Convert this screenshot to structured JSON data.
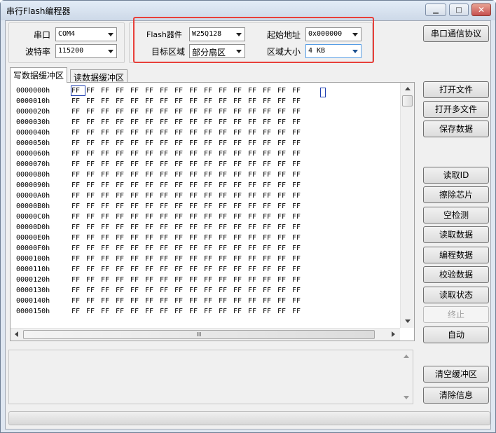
{
  "window": {
    "title": "串行Flash编程器",
    "minimize_label": "▁",
    "maximize_label": "□",
    "close_label": "✕"
  },
  "serial": {
    "port_label": "串口",
    "port_value": "COM4",
    "baud_label": "波特率",
    "baud_value": "115200"
  },
  "flash": {
    "device_label": "Flash器件",
    "device_value": "W25Q128",
    "region_label": "目标区域",
    "region_value": "部分扇区",
    "start_label": "起始地址",
    "start_value": "0x000000",
    "size_label": "区域大小",
    "size_value": "4 KB"
  },
  "protocol_button": "串口通信协议",
  "tabs": {
    "write_buffer": "写数据缓冲区",
    "read_buffer": "读数据缓冲区"
  },
  "hex": {
    "addresses": [
      "0000000h",
      "0000010h",
      "0000020h",
      "0000030h",
      "0000040h",
      "0000050h",
      "0000060h",
      "0000070h",
      "0000080h",
      "0000090h",
      "00000A0h",
      "00000B0h",
      "00000C0h",
      "00000D0h",
      "00000E0h",
      "00000F0h",
      "0000100h",
      "0000110h",
      "0000120h",
      "0000130h",
      "0000140h",
      "0000150h"
    ],
    "byte_value": "FF",
    "bytes_per_row": 16
  },
  "hscroll_grip": "III",
  "buttons": {
    "open_file": "打开文件",
    "open_multi": "打开多文件",
    "save_data": "保存数据",
    "read_id": "读取ID",
    "erase_chip": "擦除芯片",
    "blank_check": "空检测",
    "read_data": "读取数据",
    "program_data": "编程数据",
    "verify_data": "校验数据",
    "read_status": "读取状态",
    "stop": "终止",
    "auto": "自动",
    "clear_buffer": "清空缓冲区",
    "clear_info": "清除信息"
  },
  "colors": {
    "highlight_border": "#e8403a",
    "selection_border": "#1f3fb0"
  }
}
